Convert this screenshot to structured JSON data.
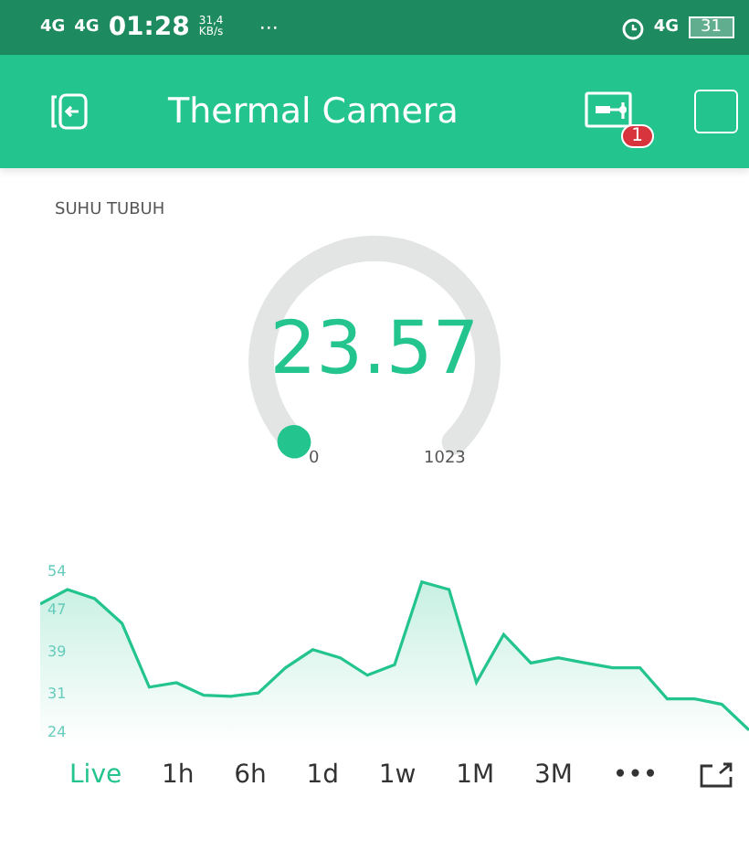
{
  "status_bar": {
    "network_1": "4G",
    "network_2": "4G",
    "time": "01:28",
    "speed": "31,4",
    "speed_unit": "KB/s",
    "more": "···",
    "network_3": "4G",
    "battery": "31"
  },
  "app_bar": {
    "title": "Thermal Camera",
    "badge": "1"
  },
  "gauge": {
    "label": "SUHU TUBUH",
    "value": "23.57",
    "min": "0",
    "max": "1023"
  },
  "chart": {
    "chart_data": {
      "type": "area",
      "yticks": [
        24,
        31,
        39,
        47,
        54
      ],
      "ylim": [
        24,
        54
      ],
      "series": [
        {
          "color": "#23c48e",
          "values": [
            48.4,
            51.1,
            49.4,
            44.8,
            32.9,
            33.7,
            31.4,
            31.2,
            31.8,
            36.5,
            39.9,
            38.4,
            35.1,
            37.1,
            52.5,
            51.1,
            33.8,
            42.7,
            37.4,
            38.4,
            37.4,
            36.5,
            36.5,
            30.7,
            30.7,
            29.7,
            24.9
          ]
        }
      ]
    }
  },
  "ranges": [
    {
      "label": "Live",
      "selected": true
    },
    {
      "label": "1h",
      "selected": false
    },
    {
      "label": "6h",
      "selected": false
    },
    {
      "label": "1d",
      "selected": false
    },
    {
      "label": "1w",
      "selected": false
    },
    {
      "label": "1M",
      "selected": false
    },
    {
      "label": "3M",
      "selected": false
    },
    {
      "label": "•••",
      "selected": false
    }
  ]
}
